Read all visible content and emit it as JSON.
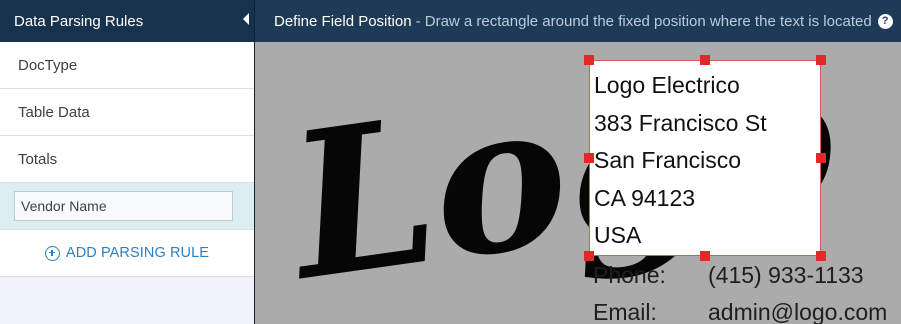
{
  "sidebar": {
    "title": "Data Parsing Rules",
    "items": [
      {
        "label": "DocType"
      },
      {
        "label": "Table Data"
      },
      {
        "label": "Totals"
      }
    ],
    "active_input_value": "Vendor Name",
    "add_rule_label": "ADD PARSING RULE"
  },
  "main": {
    "title": "Define Field Position",
    "instruction": "- Draw a rectangle around the fixed position where the text is located",
    "help_icon": "?"
  },
  "document": {
    "logo_text": "Logo",
    "selected_lines": [
      "Logo Electrico",
      "383 Francisco St",
      "San Francisco",
      "CA 94123",
      "USA"
    ],
    "phone_label": "Phone:",
    "phone_value": "(415) 933-1133",
    "email_label": "Email:",
    "email_value": "admin@logo.com"
  },
  "colors": {
    "header_bg": "#1d3a57",
    "sidebar_header_bg": "#17324d",
    "accent_blue": "#2d7fc3",
    "selection_red": "#e02a2a",
    "active_row": "#dcedf4"
  }
}
